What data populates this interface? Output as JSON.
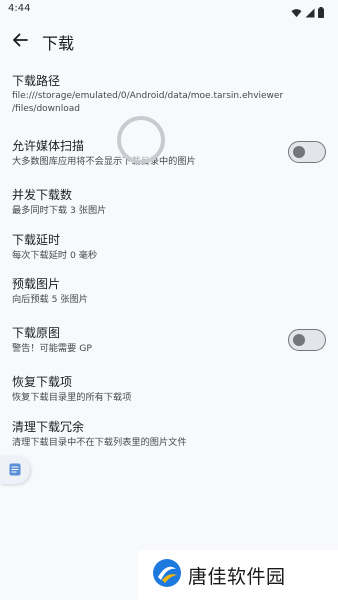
{
  "status_bar": {
    "time": "4:44",
    "icons": [
      "wifi-icon",
      "signal-icon",
      "battery-icon"
    ]
  },
  "app_bar": {
    "title": "下载",
    "back_icon": "arrow-back-icon"
  },
  "preferences": {
    "download_path": {
      "title": "下载路径",
      "summary_line1": "file:///storage/emulated/0/Android/data/moe.tarsin.ehviewer",
      "summary_line2": "/files/download"
    },
    "media_scan": {
      "title": "允许媒体扫描",
      "summary": "大多数图库应用将不会显示下载目录中的图片",
      "enabled": false
    },
    "concurrency": {
      "title": "并发下载数",
      "summary": "最多同时下载 3 张图片"
    },
    "delay": {
      "title": "下载延时",
      "summary": "每次下载延时 0 毫秒"
    },
    "preload": {
      "title": "预载图片",
      "summary": "向后预载 5 张图片"
    },
    "original": {
      "title": "下载原图",
      "summary": "警告！可能需要 GP",
      "enabled": false
    },
    "restore": {
      "title": "恢复下载项",
      "summary": "恢复下载目录里的所有下载项"
    },
    "clean": {
      "title": "清理下载冗余",
      "summary": "清理下载目录中不在下载列表里的图片文件"
    }
  },
  "watermark": {
    "text": "唐佳软件园"
  },
  "colors": {
    "background": "#f7f9fd",
    "text_primary": "#1c1d21",
    "text_secondary": "#47484c",
    "switch_outline": "#74767b"
  }
}
